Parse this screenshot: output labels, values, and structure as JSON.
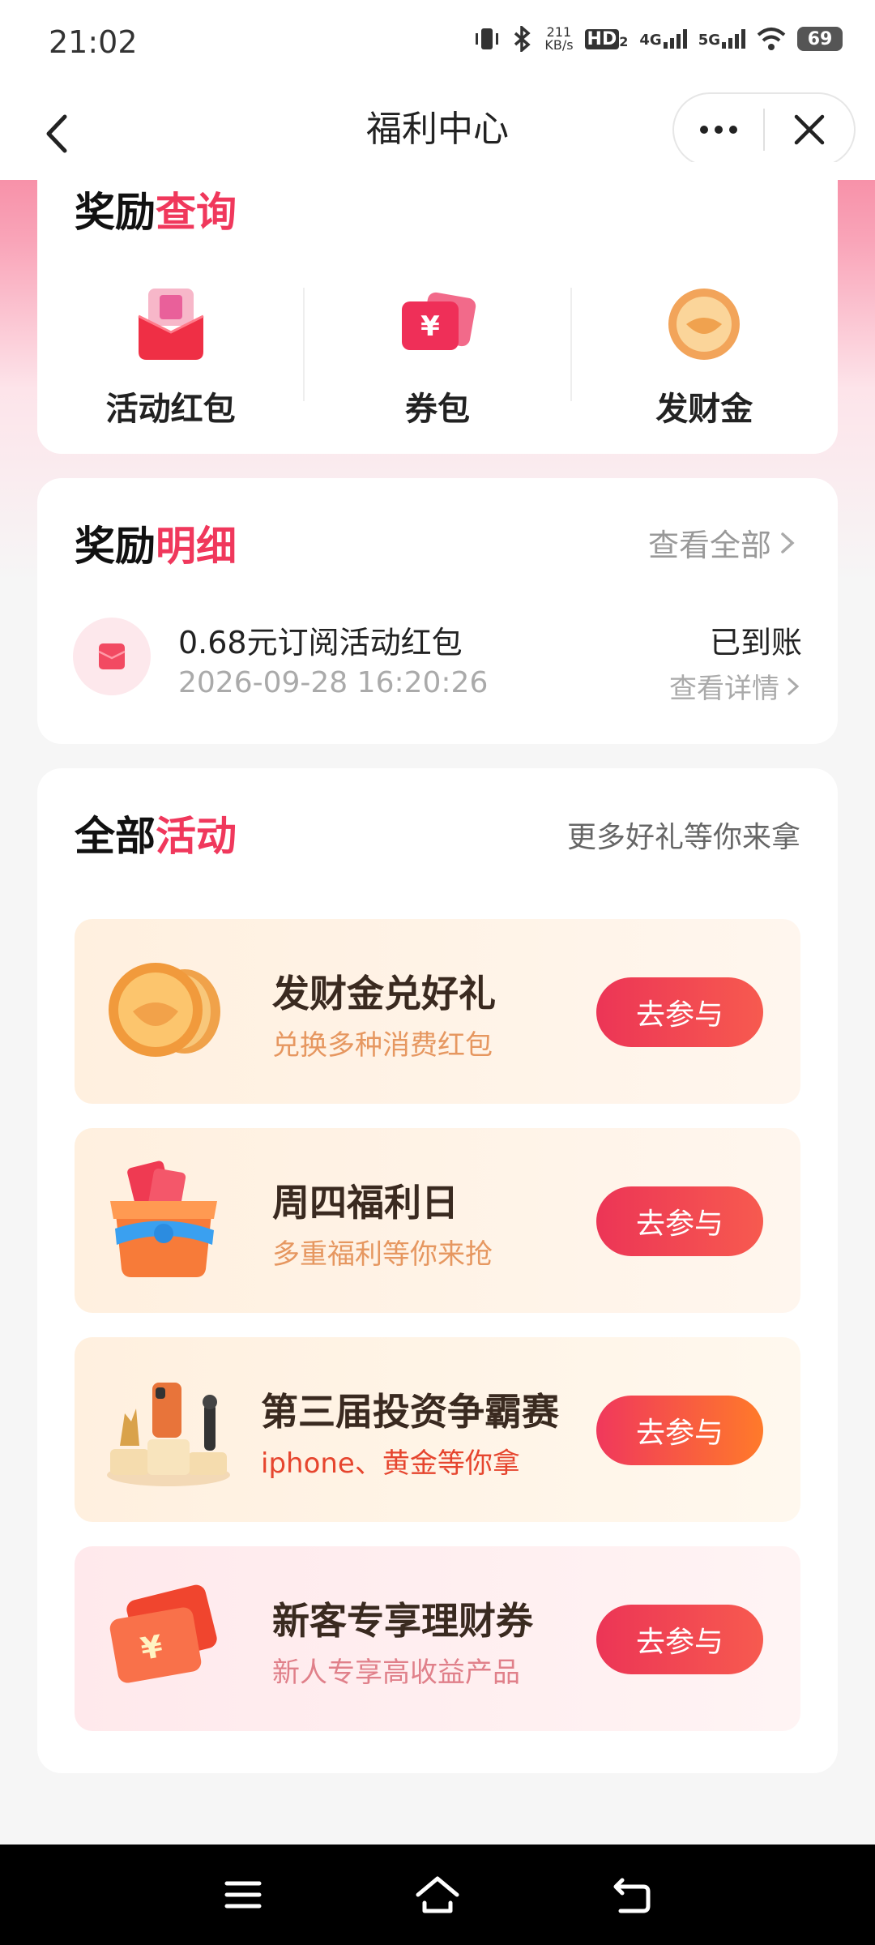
{
  "status": {
    "time": "21:02",
    "net_speed_top": "211",
    "net_speed_unit": "KB/s",
    "hd": "HD",
    "hd_sub": "2",
    "sig1": "4G",
    "sig2": "5G",
    "battery": "69"
  },
  "nav": {
    "title": "福利中心",
    "back_icon": "chevron-left-icon",
    "more_icon": "more-dots-icon",
    "close_icon": "close-icon"
  },
  "rewards_query": {
    "title_plain": "奖励",
    "title_highlight": "查询",
    "items": [
      {
        "label": "活动红包",
        "icon": "red-envelope-icon"
      },
      {
        "label": "券包",
        "icon": "coupon-icon"
      },
      {
        "label": "发财金",
        "icon": "gold-ingot-icon"
      }
    ]
  },
  "rewards_detail": {
    "title_plain": "奖励",
    "title_highlight": "明细",
    "see_all": "查看全部",
    "record": {
      "name": "0.68元订阅活动红包",
      "time": "2026-09-28 16:20:26",
      "status": "已到账",
      "link": "查看详情"
    }
  },
  "all_activities": {
    "title_plain": "全部",
    "title_highlight": "活动",
    "more": "更多好礼等你来拿",
    "items": [
      {
        "name": "发财金兑好礼",
        "sub": "兑换多种消费红包",
        "button": "去参与",
        "icon": "gold-coins-icon"
      },
      {
        "name": "周四福利日",
        "sub": "多重福利等你来抢",
        "button": "去参与",
        "icon": "gift-box-icon"
      },
      {
        "name": "第三届投资争霸赛",
        "sub": "iphone、黄金等你拿",
        "button": "去参与",
        "icon": "trophy-podium-icon"
      },
      {
        "name": "新客专享理财券",
        "sub": "新人专享高收益产品",
        "button": "去参与",
        "icon": "ticket-icon"
      }
    ]
  },
  "colors": {
    "accent": "#f0385c",
    "card_bg_warm": "#fff3e6",
    "card_bg_pink": "#fff0f0"
  }
}
